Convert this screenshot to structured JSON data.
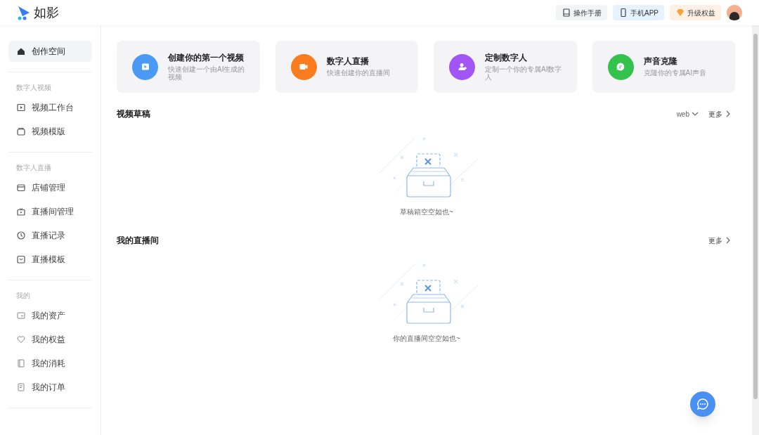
{
  "header": {
    "logo": "如影",
    "buttons": [
      {
        "kind": "manual",
        "label": "操作手册"
      },
      {
        "kind": "app",
        "label": "手机APP"
      },
      {
        "kind": "upgrade",
        "label": "升级权益"
      }
    ]
  },
  "sidebar": {
    "groups": [
      {
        "items": [
          {
            "label": "创作空间",
            "kind": "home",
            "selected": true
          }
        ]
      },
      {
        "label": "数字人视频",
        "items": [
          {
            "label": "视频工作台",
            "kind": "play",
            "selected": false
          },
          {
            "label": "视频模版",
            "kind": "box",
            "selected": false
          }
        ]
      },
      {
        "label": "数字人直播",
        "items": [
          {
            "label": "店铺管理",
            "kind": "store",
            "selected": false
          },
          {
            "label": "直播间管理",
            "kind": "tv",
            "selected": false
          },
          {
            "label": "直播记录",
            "kind": "clock",
            "selected": false
          },
          {
            "label": "直播模板",
            "kind": "bag",
            "selected": false
          }
        ]
      },
      {
        "label": "我的",
        "items": [
          {
            "label": "我的资产",
            "kind": "card",
            "selected": false
          },
          {
            "label": "我的权益",
            "kind": "heart",
            "selected": false
          },
          {
            "label": "我的消耗",
            "kind": "book",
            "selected": false
          },
          {
            "label": "我的订单",
            "kind": "doc",
            "selected": false
          }
        ]
      }
    ]
  },
  "cards": [
    {
      "kind": "video",
      "title": "创建你的第一个视频",
      "subtitle": "快速创建一个由AI生成的视频",
      "color": "#4a9af5"
    },
    {
      "kind": "camera",
      "title": "数字人直播",
      "subtitle": "快速创建你的直播间",
      "color": "#fa7c1e"
    },
    {
      "kind": "user",
      "title": "定制数字人",
      "subtitle": "定制一个你的专属AI数字人",
      "color": "#a155f5"
    },
    {
      "kind": "chat",
      "title": "声音克隆",
      "subtitle": "克隆你的专属AI声音",
      "color": "#33c24d"
    }
  ],
  "sections": [
    {
      "title": "视频草稿",
      "filter": "web",
      "more": "更多",
      "empty_text": "草稿箱空空如也~"
    },
    {
      "title": "我的直播间",
      "more": "更多",
      "empty_text": "你的直播间空空如也~"
    }
  ]
}
